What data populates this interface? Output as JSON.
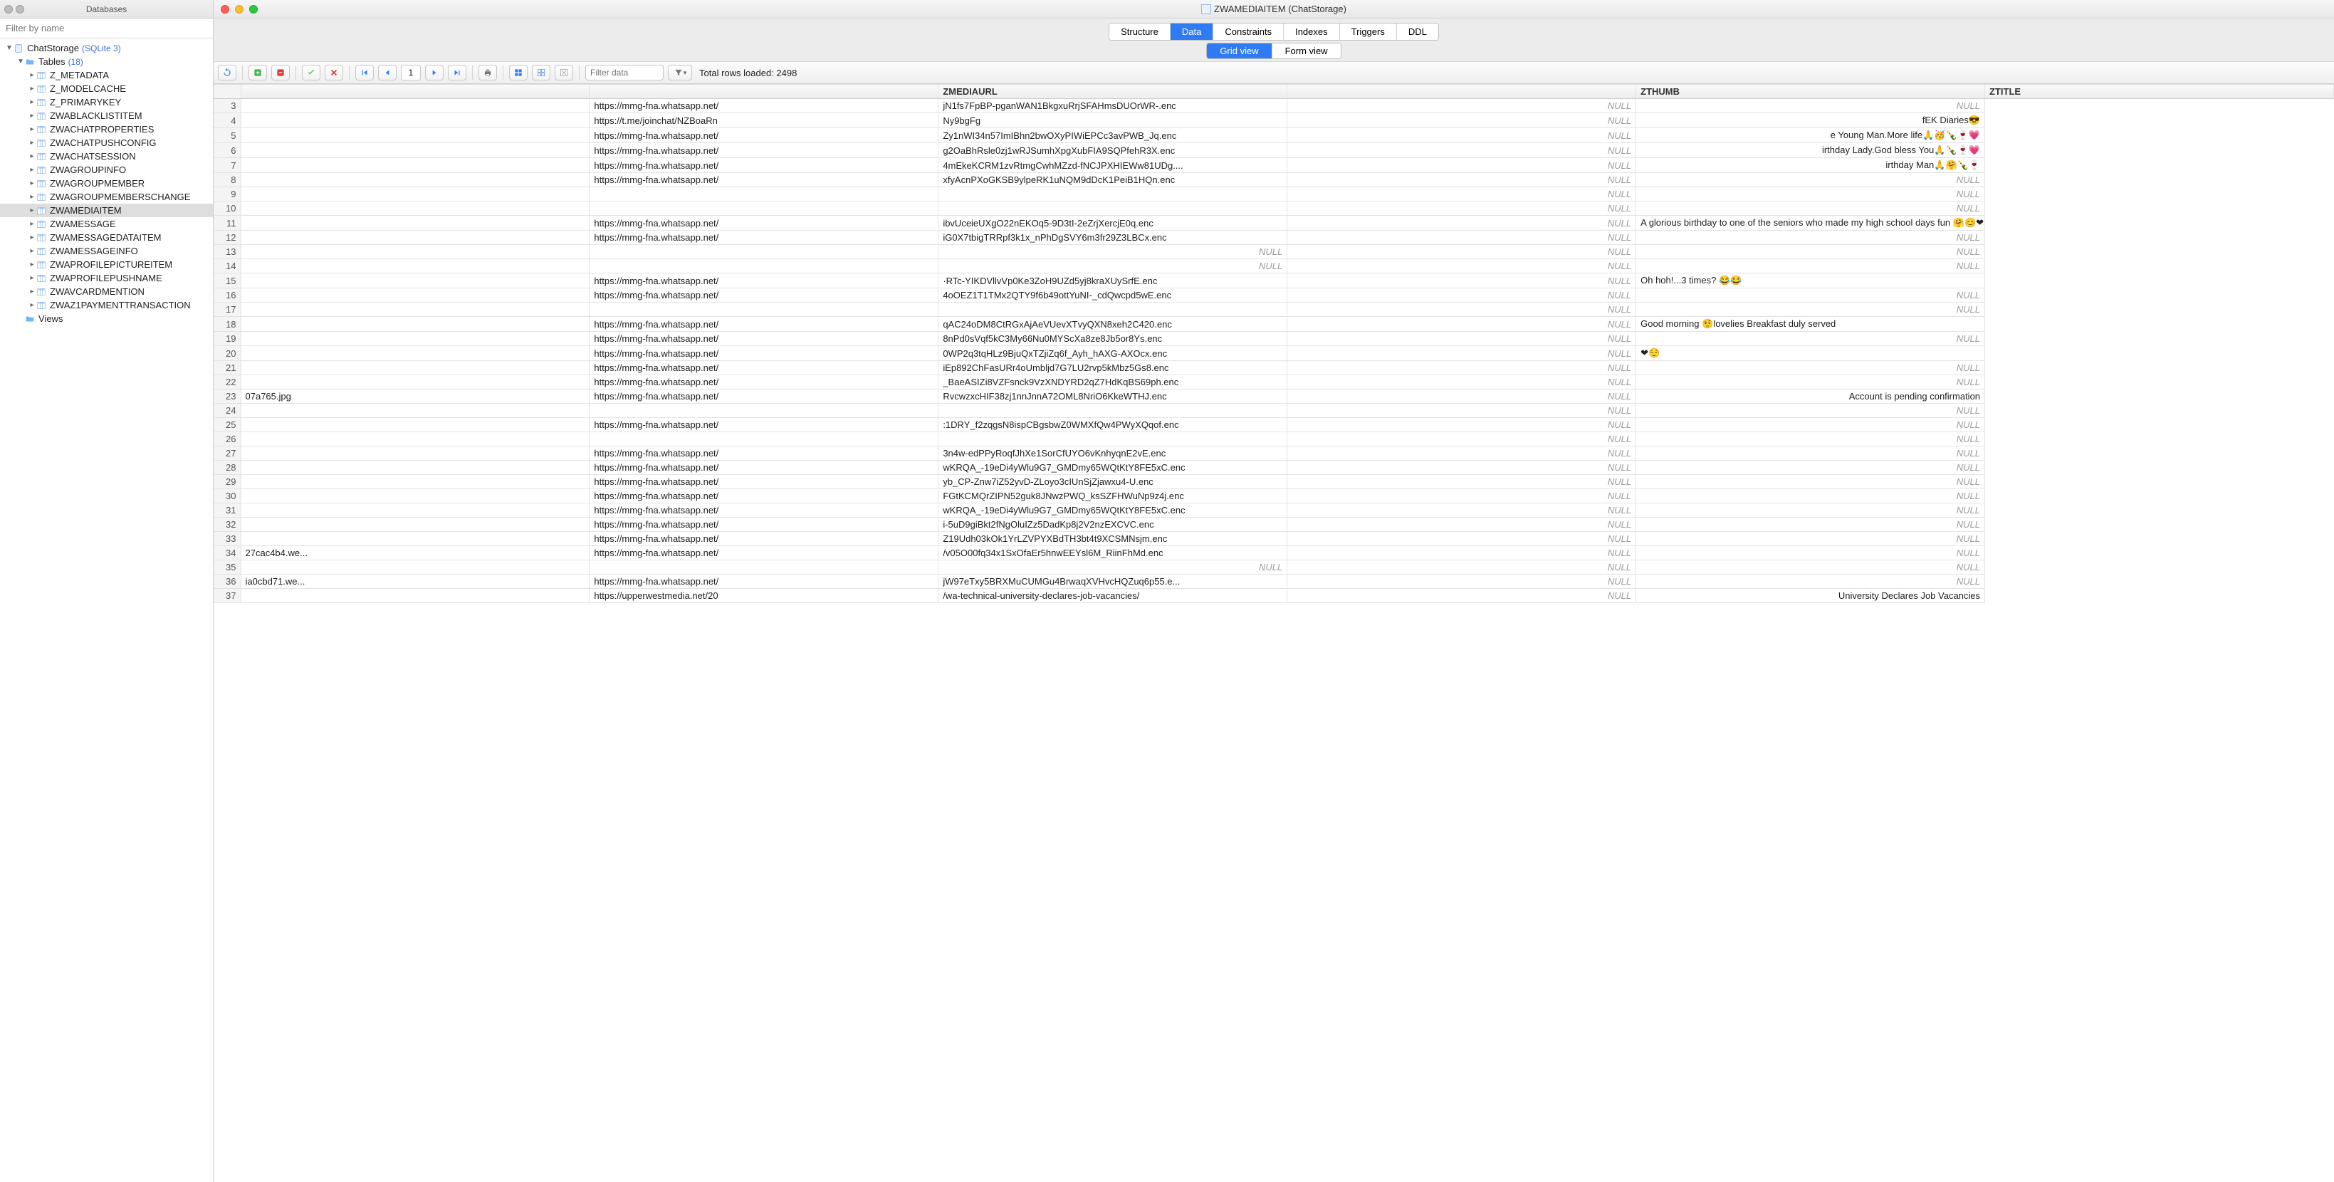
{
  "left": {
    "title": "Databases",
    "filter_placeholder": "Filter by name",
    "db_name": "ChatStorage",
    "db_badge": "(SQLite 3)",
    "tables_label": "Tables",
    "tables_badge": "(18)",
    "views_label": "Views",
    "tables": [
      "Z_METADATA",
      "Z_MODELCACHE",
      "Z_PRIMARYKEY",
      "ZWABLACKLISTITEM",
      "ZWACHATPROPERTIES",
      "ZWACHATPUSHCONFIG",
      "ZWACHATSESSION",
      "ZWAGROUPINFO",
      "ZWAGROUPMEMBER",
      "ZWAGROUPMEMBERSCHANGE",
      "ZWAMEDIAITEM",
      "ZWAMESSAGE",
      "ZWAMESSAGEDATAITEM",
      "ZWAMESSAGEINFO",
      "ZWAPROFILEPICTUREITEM",
      "ZWAPROFILEPUSHNAME",
      "ZWAVCARDMENTION",
      "ZWAZ1PAYMENTTRANSACTION"
    ],
    "selected_table": "ZWAMEDIAITEM"
  },
  "window": {
    "title": "ZWAMEDIAITEM (ChatStorage)",
    "tabs": [
      "Structure",
      "Data",
      "Constraints",
      "Indexes",
      "Triggers",
      "DDL"
    ],
    "active_tab": "Data",
    "subtabs": [
      "Grid view",
      "Form view"
    ],
    "active_subtab": "Grid view"
  },
  "toolbar": {
    "page": "1",
    "filter_placeholder": "Filter data",
    "total": "Total rows loaded: 2498"
  },
  "columns": [
    "",
    "",
    "ZMEDIAURL",
    "",
    "ZTHUMB",
    "ZTITLE"
  ],
  "rows": [
    {
      "n": "3",
      "c1": "",
      "url": "https://mmg-fna.whatsapp.net/",
      "c3": "jN1fs7FpBP-pganWAN1BkgxuRrjSFAHmsDUOrWR-.enc",
      "thumb": "NULL",
      "title": "NULL"
    },
    {
      "n": "4",
      "c1": "",
      "url": "https://t.me/joinchat/NZBoaRn",
      "c3": "Ny9bgFg",
      "thumb": "NULL",
      "title": "fEK Diaries😎",
      "title_style": "text"
    },
    {
      "n": "5",
      "c1": "",
      "url": "https://mmg-fna.whatsapp.net/",
      "c3": "Zy1nWI34n57ImIBhn2bwOXyPIWiEPCc3avPWB_Jq.enc",
      "thumb": "NULL",
      "title": "e Young Man.More life🙏🥳🍾🍷💗",
      "title_style": "text"
    },
    {
      "n": "6",
      "c1": "",
      "url": "https://mmg-fna.whatsapp.net/",
      "c3": "g2OaBhRsle0zj1wRJSumhXpgXubFIA9SQPfehR3X.enc",
      "thumb": "NULL",
      "title": "irthday Lady.God bless You🙏🍾🍷💗",
      "title_style": "text"
    },
    {
      "n": "7",
      "c1": "",
      "url": "https://mmg-fna.whatsapp.net/",
      "c3": "4mEkeKCRM1zvRtmgCwhMZzd-fNCJPXHIEWw81UDg....",
      "thumb": "NULL",
      "title": "irthday Man🙏🤗🍾🍷",
      "title_style": "text"
    },
    {
      "n": "8",
      "c1": "",
      "url": "https://mmg-fna.whatsapp.net/",
      "c3": "xfyAcnPXoGKSB9ylpeRK1uNQM9dDcK1PeiB1HQn.enc",
      "thumb": "NULL",
      "title": "NULL"
    },
    {
      "n": "9",
      "c1": "",
      "url": "",
      "c3": "",
      "thumb": "NULL",
      "title": "NULL"
    },
    {
      "n": "10",
      "c1": "",
      "url": "",
      "c3": "",
      "thumb": "NULL",
      "title": "NULL"
    },
    {
      "n": "11",
      "c1": "",
      "url": "https://mmg-fna.whatsapp.net/",
      "c3": "ibvUceieUXgO22nEKOq5-9D3tI-2eZrjXercjE0q.enc",
      "thumb": "NULL",
      "title": "A glorious birthday to one of the seniors who made my high school days fun 🤗😊❤. G",
      "title_style": "text-left"
    },
    {
      "n": "12",
      "c1": "",
      "url": "https://mmg-fna.whatsapp.net/",
      "c3": "iG0X7tbigTRRpf3k1x_nPhDgSVY6m3fr29Z3LBCx.enc",
      "thumb": "NULL",
      "title": "NULL"
    },
    {
      "n": "13",
      "c1": "",
      "url": "",
      "c3": "NULL",
      "c3_null": true,
      "thumb": "NULL",
      "title": "NULL"
    },
    {
      "n": "14",
      "c1": "",
      "url": "",
      "c3": "NULL",
      "c3_null": true,
      "thumb": "NULL",
      "title": "NULL"
    },
    {
      "n": "15",
      "c1": "",
      "url": "https://mmg-fna.whatsapp.net/",
      "c3": "·RTc-YIKDVllvVp0Ke3ZoH9UZd5yj8kraXUySrfE.enc",
      "thumb": "NULL",
      "title": "Oh hoh!...3 times? 😂😂",
      "title_style": "text-left"
    },
    {
      "n": "16",
      "c1": "",
      "url": "https://mmg-fna.whatsapp.net/",
      "c3": "4oOEZ1T1TMx2QTY9f6b49ottYuNI-_cdQwcpd5wE.enc",
      "thumb": "NULL",
      "title": "NULL"
    },
    {
      "n": "17",
      "c1": "",
      "url": "",
      "c3": "",
      "thumb": "NULL",
      "title": "NULL"
    },
    {
      "n": "18",
      "c1": "",
      "url": "https://mmg-fna.whatsapp.net/",
      "c3": "qAC24oDM8CtRGxAjAeVUevXTvyQXN8xeh2C420.enc",
      "thumb": "NULL",
      "title": "Good morning 🤨lovelies  Breakfast duly served",
      "title_style": "text-left"
    },
    {
      "n": "19",
      "c1": "",
      "url": "https://mmg-fna.whatsapp.net/",
      "c3": "8nPd0sVqf5kC3My66Nu0MYScXa8ze8Jb5or8Ys.enc",
      "thumb": "NULL",
      "title": "NULL"
    },
    {
      "n": "20",
      "c1": "",
      "url": "https://mmg-fna.whatsapp.net/",
      "c3": "0WP2q3tqHLz9BjuQxTZjiZq6f_Ayh_hAXG-AXOcx.enc",
      "thumb": "NULL",
      "title": "❤😌",
      "title_style": "text-left"
    },
    {
      "n": "21",
      "c1": "",
      "url": "https://mmg-fna.whatsapp.net/",
      "c3": "iEp892ChFasURr4oUmbljd7G7LU2rvp5kMbz5Gs8.enc",
      "thumb": "NULL",
      "title": "NULL"
    },
    {
      "n": "22",
      "c1": "",
      "url": "https://mmg-fna.whatsapp.net/",
      "c3": "_BaeASIZi8VZFsnck9VzXNDYRD2qZ7HdKqBS69ph.enc",
      "thumb": "NULL",
      "title": "NULL"
    },
    {
      "n": "23",
      "c1": "07a765.jpg",
      "url": "https://mmg-fna.whatsapp.net/",
      "c3": "RvcwzxcHIF38zj1nnJnnA72OML8NriO6KkeWTHJ.enc",
      "thumb": "NULL",
      "title": "Account is pending confirmation",
      "title_style": "text"
    },
    {
      "n": "24",
      "c1": "",
      "url": "",
      "c3": "",
      "thumb": "NULL",
      "title": "NULL"
    },
    {
      "n": "25",
      "c1": "",
      "url": "https://mmg-fna.whatsapp.net/",
      "c3": ":1DRY_f2zqgsN8ispCBgsbwZ0WMXfQw4PWyXQqof.enc",
      "thumb": "NULL",
      "title": "NULL"
    },
    {
      "n": "26",
      "c1": "",
      "url": "",
      "c3": "",
      "thumb": "NULL",
      "title": "NULL"
    },
    {
      "n": "27",
      "c1": "",
      "url": "https://mmg-fna.whatsapp.net/",
      "c3": "3n4w-edPPyRoqfJhXe1SorCfUYO6vKnhyqnE2vE.enc",
      "thumb": "NULL",
      "title": "NULL"
    },
    {
      "n": "28",
      "c1": "",
      "url": "https://mmg-fna.whatsapp.net/",
      "c3": "wKRQA_-19eDi4yWlu9G7_GMDmy65WQtKtY8FE5xC.enc",
      "thumb": "NULL",
      "title": "NULL"
    },
    {
      "n": "29",
      "c1": "",
      "url": "https://mmg-fna.whatsapp.net/",
      "c3": "yb_CP-Znw7iZ52yvD-ZLoyo3cIUnSjZjawxu4-U.enc",
      "thumb": "NULL",
      "title": "NULL"
    },
    {
      "n": "30",
      "c1": "",
      "url": "https://mmg-fna.whatsapp.net/",
      "c3": "FGtKCMQrZIPN52guk8JNwzPWQ_ksSZFHWuNp9z4j.enc",
      "thumb": "NULL",
      "title": "NULL"
    },
    {
      "n": "31",
      "c1": "",
      "url": "https://mmg-fna.whatsapp.net/",
      "c3": "wKRQA_-19eDi4yWlu9G7_GMDmy65WQtKtY8FE5xC.enc",
      "thumb": "NULL",
      "title": "NULL"
    },
    {
      "n": "32",
      "c1": "",
      "url": "https://mmg-fna.whatsapp.net/",
      "c3": "i-5uD9giBkt2fNgOluIZz5DadKp8j2V2nzEXCVC.enc",
      "thumb": "NULL",
      "title": "NULL"
    },
    {
      "n": "33",
      "c1": "",
      "url": "https://mmg-fna.whatsapp.net/",
      "c3": "Z19Udh03kOk1YrLZVPYXBdTH3bt4t9XCSMNsjm.enc",
      "thumb": "NULL",
      "title": "NULL"
    },
    {
      "n": "34",
      "c1": "27cac4b4.we...",
      "url": "https://mmg-fna.whatsapp.net/",
      "c3": "/v05O00fq34x1SxOfaEr5hnwEEYsl6M_RiinFhMd.enc",
      "thumb": "NULL",
      "title": "NULL"
    },
    {
      "n": "35",
      "c1": "",
      "url": "",
      "c3": "NULL",
      "c3_null": true,
      "thumb": "NULL",
      "title": "NULL"
    },
    {
      "n": "36",
      "c1": "ia0cbd71.we...",
      "url": "https://mmg-fna.whatsapp.net/",
      "c3": "jW97eTxy5BRXMuCUMGu4BrwaqXVHvcHQZuq6p55.e...",
      "thumb": "NULL",
      "title": "NULL"
    },
    {
      "n": "37",
      "c1": "",
      "url": "https://upperwestmedia.net/20",
      "c3": "/wa-technical-university-declares-job-vacancies/",
      "thumb": "NULL",
      "title": "University Declares Job Vacancies",
      "title_style": "text"
    }
  ]
}
